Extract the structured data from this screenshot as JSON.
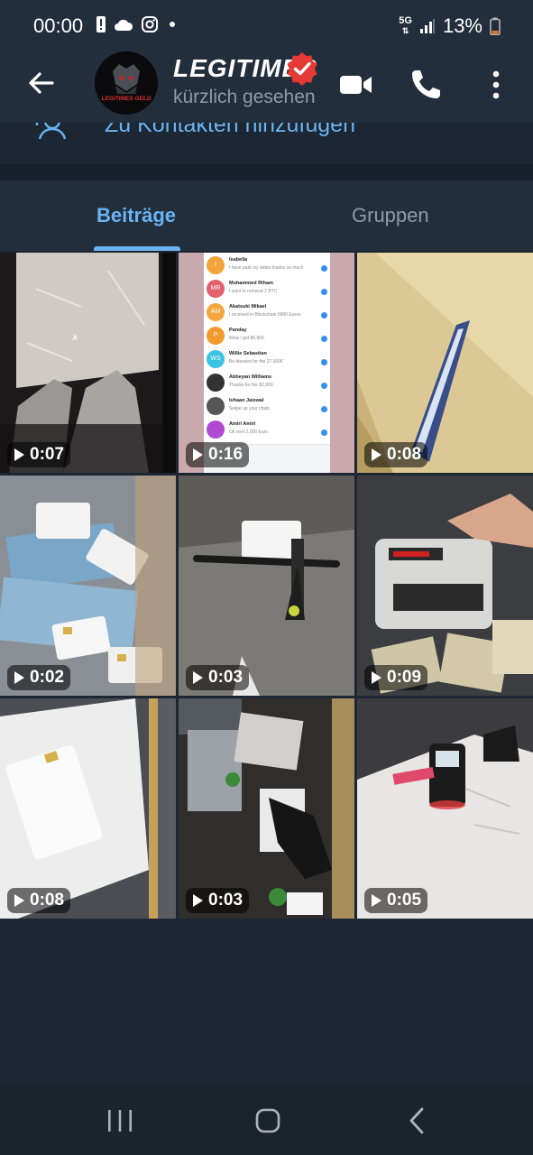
{
  "status_bar": {
    "time": "00:00",
    "network": "5G",
    "battery": "13%"
  },
  "header": {
    "title": "LEGITIMES GELD",
    "subtitle": "kürzlich gesehen",
    "avatar_text": "LEGITIMES GELD"
  },
  "add_contact": {
    "label": "Zu Kontakten hinzufügen"
  },
  "tabs": [
    {
      "label": "Beiträge",
      "active": true
    },
    {
      "label": "Gruppen",
      "active": false
    }
  ],
  "media": [
    {
      "duration": "0:07",
      "icon": "video-thumb-legs-icon"
    },
    {
      "duration": "0:16",
      "icon": "video-thumb-chatlist-icon"
    },
    {
      "duration": "0:08",
      "icon": "video-thumb-envelope-icon"
    },
    {
      "duration": "0:02",
      "icon": "video-thumb-banknotes-cards-icon"
    },
    {
      "duration": "0:03",
      "icon": "video-thumb-scooter-card-icon"
    },
    {
      "duration": "0:09",
      "icon": "video-thumb-counting-machine-icon"
    },
    {
      "duration": "0:08",
      "icon": "video-thumb-card-envelope-icon"
    },
    {
      "duration": "0:03",
      "icon": "video-thumb-laptop-cards-icon"
    },
    {
      "duration": "0:05",
      "icon": "video-thumb-card-terminal-icon"
    }
  ],
  "chat_preview": {
    "rows": [
      {
        "initials": "I",
        "color": "#f3a33a",
        "name": "Isabella",
        "text": "I have paid my debts thanks so much"
      },
      {
        "initials": "MR",
        "color": "#e4606d",
        "name": "Mohammed Riham",
        "text": "I want to reinvest 2 BTC"
      },
      {
        "initials": "AM",
        "color": "#f5a63c",
        "name": "Akatsuki Mikael",
        "text": "I received in Blockchain 5800 Euros"
      },
      {
        "initials": "P",
        "color": "#f39a2f",
        "name": "Panday",
        "text": "Wow I got $6,800"
      },
      {
        "initials": "WS",
        "color": "#39c3e0",
        "name": "Willie Sebastian",
        "text": "Be blessed for the 27,000€"
      },
      {
        "initials": "",
        "color": "#333333",
        "name": "Abbeyan Williams",
        "text": "Thanks for the $2,800"
      },
      {
        "initials": "",
        "color": "#555555",
        "name": "Ishaan Jaiswal",
        "text": "Swipe up your chats"
      },
      {
        "initials": "",
        "color": "#b04ad0",
        "name": "Amiri Amiri",
        "text": "Ok sent 2,000 Euro"
      }
    ]
  },
  "nav_bar": {
    "items": [
      "recent-apps",
      "home",
      "back"
    ]
  },
  "colors": {
    "accent": "#6ab3f3",
    "background": "#1d2733",
    "header": "#232e3c",
    "verified": "#e53935"
  }
}
